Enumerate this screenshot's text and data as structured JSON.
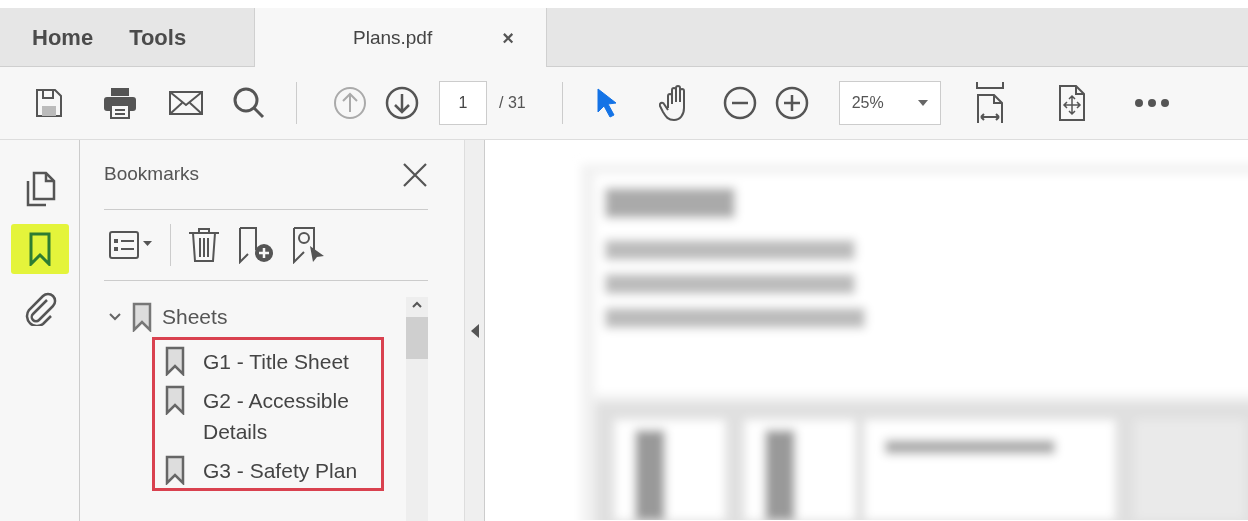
{
  "top_tabs": [
    {
      "label": "Home",
      "selected": false
    },
    {
      "label": "Tools",
      "selected": false
    }
  ],
  "document_tab": {
    "title": "Plans.pdf",
    "close": "×",
    "selected": true
  },
  "toolbar": {
    "page_number": "1",
    "page_total": "/ 31",
    "zoom": "25%",
    "tools": [
      {
        "kind": "pointer",
        "selected": true
      },
      {
        "kind": "hand",
        "selected": false
      }
    ]
  },
  "side_rail": [
    {
      "kind": "pages",
      "selected": false
    },
    {
      "kind": "bookmarks",
      "selected": true
    },
    {
      "kind": "attachments",
      "selected": false
    }
  ],
  "bookmarks_panel": {
    "title": "Bookmarks",
    "tree": [
      {
        "label": "Sheets",
        "expanded": true,
        "children_highlighted": true,
        "children": [
          {
            "label": "G1 - Title Sheet"
          },
          {
            "label": "G2 - Accessible Details"
          },
          {
            "label": "G3 - Safety Plan"
          }
        ]
      }
    ]
  }
}
